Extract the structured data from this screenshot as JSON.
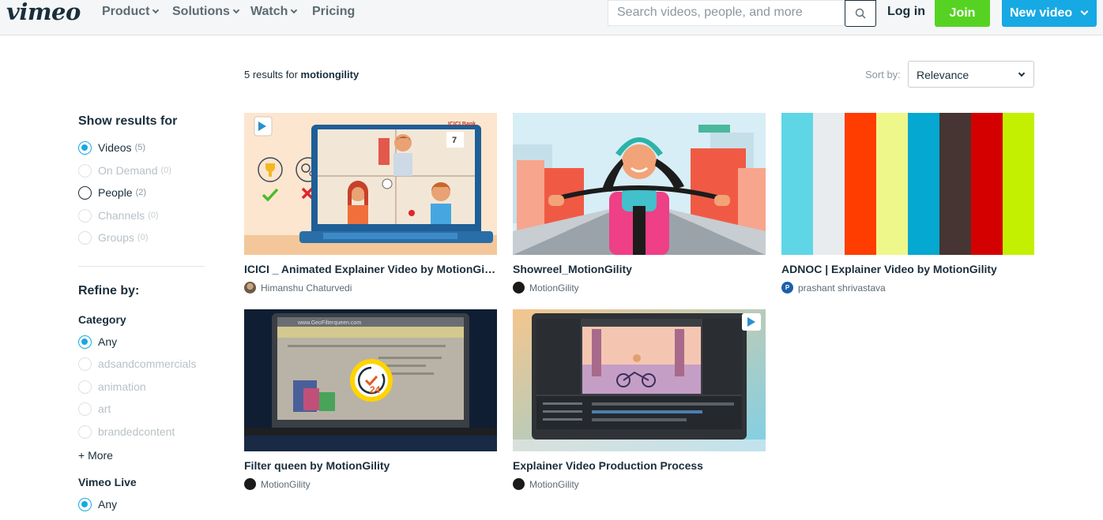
{
  "header": {
    "logo": "vimeo",
    "nav": [
      {
        "label": "Product",
        "dropdown": true
      },
      {
        "label": "Solutions",
        "dropdown": true
      },
      {
        "label": "Watch",
        "dropdown": true
      },
      {
        "label": "Pricing",
        "dropdown": false
      }
    ],
    "search_placeholder": "Search videos, people, and more",
    "login_label": "Log in",
    "join_label": "Join",
    "new_video_label": "New video"
  },
  "results": {
    "count_text": "5 results for",
    "query": "motiongility",
    "sort_label": "Sort by:",
    "sort_value": "Relevance"
  },
  "sidebar": {
    "show_results_heading": "Show results for",
    "show_results": [
      {
        "label": "Videos",
        "count": "(5)",
        "selected": true,
        "enabled": true
      },
      {
        "label": "On Demand",
        "count": "(0)",
        "selected": false,
        "enabled": false
      },
      {
        "label": "People",
        "count": "(2)",
        "selected": false,
        "enabled": true
      },
      {
        "label": "Channels",
        "count": "(0)",
        "selected": false,
        "enabled": false
      },
      {
        "label": "Groups",
        "count": "(0)",
        "selected": false,
        "enabled": false
      }
    ],
    "refine_heading": "Refine by:",
    "category_heading": "Category",
    "categories": [
      {
        "label": "Any",
        "selected": true,
        "enabled": true
      },
      {
        "label": "adsandcommercials",
        "selected": false,
        "enabled": false
      },
      {
        "label": "animation",
        "selected": false,
        "enabled": false
      },
      {
        "label": "art",
        "selected": false,
        "enabled": false
      },
      {
        "label": "brandedcontent",
        "selected": false,
        "enabled": false
      }
    ],
    "more_label": "+ More",
    "live_heading": "Vimeo Live",
    "live_options": [
      {
        "label": "Any",
        "selected": true,
        "enabled": true
      }
    ]
  },
  "videos": [
    {
      "title": "ICICI _ Animated Explainer Video by MotionGility",
      "author": "Himanshu Chaturvedi",
      "avatar": "photo"
    },
    {
      "title": "Showreel_MotionGility",
      "author": "MotionGility",
      "avatar": "dark"
    },
    {
      "title": "ADNOC | Explainer Video by MotionGility",
      "author": "prashant shrivastava",
      "avatar": "P"
    },
    {
      "title": "Filter queen by MotionGility",
      "author": "MotionGility",
      "avatar": "dark"
    },
    {
      "title": "Explainer Video Production Process",
      "author": "MotionGility",
      "avatar": "dark"
    }
  ],
  "thumb_texts": {
    "icici_bank": "ICICI Bank",
    "clock_number": "24",
    "website_url": "www.GeoFilterqueen.com"
  },
  "colors": {
    "brand_blue": "#17a9e3",
    "join_green": "#56d322",
    "text_dark": "#1a2e3b",
    "adnoc_stripes": [
      "#5fd6e6",
      "#e8ecee",
      "#ff3d00",
      "#eef78a",
      "#05a8d1",
      "#463532",
      "#d40000",
      "#c3f000"
    ]
  }
}
